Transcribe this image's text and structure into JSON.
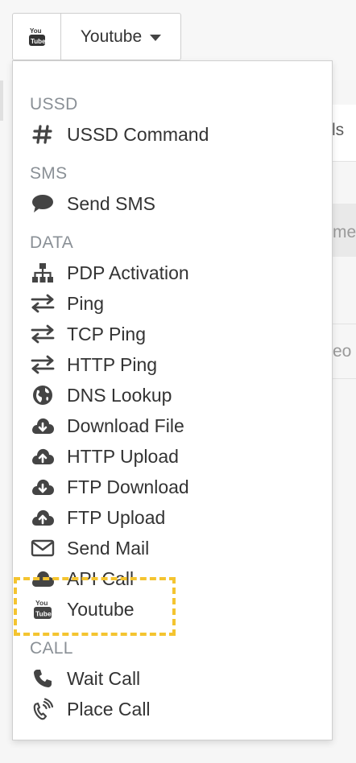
{
  "toolbar": {
    "selected_label": "Youtube",
    "icon": "youtube-icon"
  },
  "background_fragments": {
    "frag1": "ls",
    "frag2": "me",
    "frag3": "eo"
  },
  "menu": {
    "groups": [
      {
        "header": "USSD",
        "items": [
          {
            "label": "USSD Command",
            "icon": "hash-icon"
          }
        ]
      },
      {
        "header": "SMS",
        "items": [
          {
            "label": "Send SMS",
            "icon": "comment-icon"
          }
        ]
      },
      {
        "header": "DATA",
        "items": [
          {
            "label": "PDP Activation",
            "icon": "sitemap-icon"
          },
          {
            "label": "Ping",
            "icon": "exchange-icon"
          },
          {
            "label": "TCP Ping",
            "icon": "exchange-icon"
          },
          {
            "label": "HTTP Ping",
            "icon": "exchange-icon"
          },
          {
            "label": "DNS Lookup",
            "icon": "globe-icon"
          },
          {
            "label": "Download File",
            "icon": "cloud-download-icon"
          },
          {
            "label": "HTTP Upload",
            "icon": "cloud-upload-icon"
          },
          {
            "label": "FTP Download",
            "icon": "cloud-download-icon"
          },
          {
            "label": "FTP Upload",
            "icon": "cloud-upload-icon"
          },
          {
            "label": "Send Mail",
            "icon": "envelope-icon"
          },
          {
            "label": "API Call",
            "icon": "cloud-icon"
          },
          {
            "label": "Youtube",
            "icon": "youtube-icon"
          }
        ]
      },
      {
        "header": "CALL",
        "items": [
          {
            "label": "Wait Call",
            "icon": "phone-icon"
          },
          {
            "label": "Place Call",
            "icon": "phone-ringing-icon"
          }
        ]
      }
    ]
  },
  "colors": {
    "highlight": "#f4c430",
    "group_header": "#8a9096",
    "icon": "#444444"
  }
}
